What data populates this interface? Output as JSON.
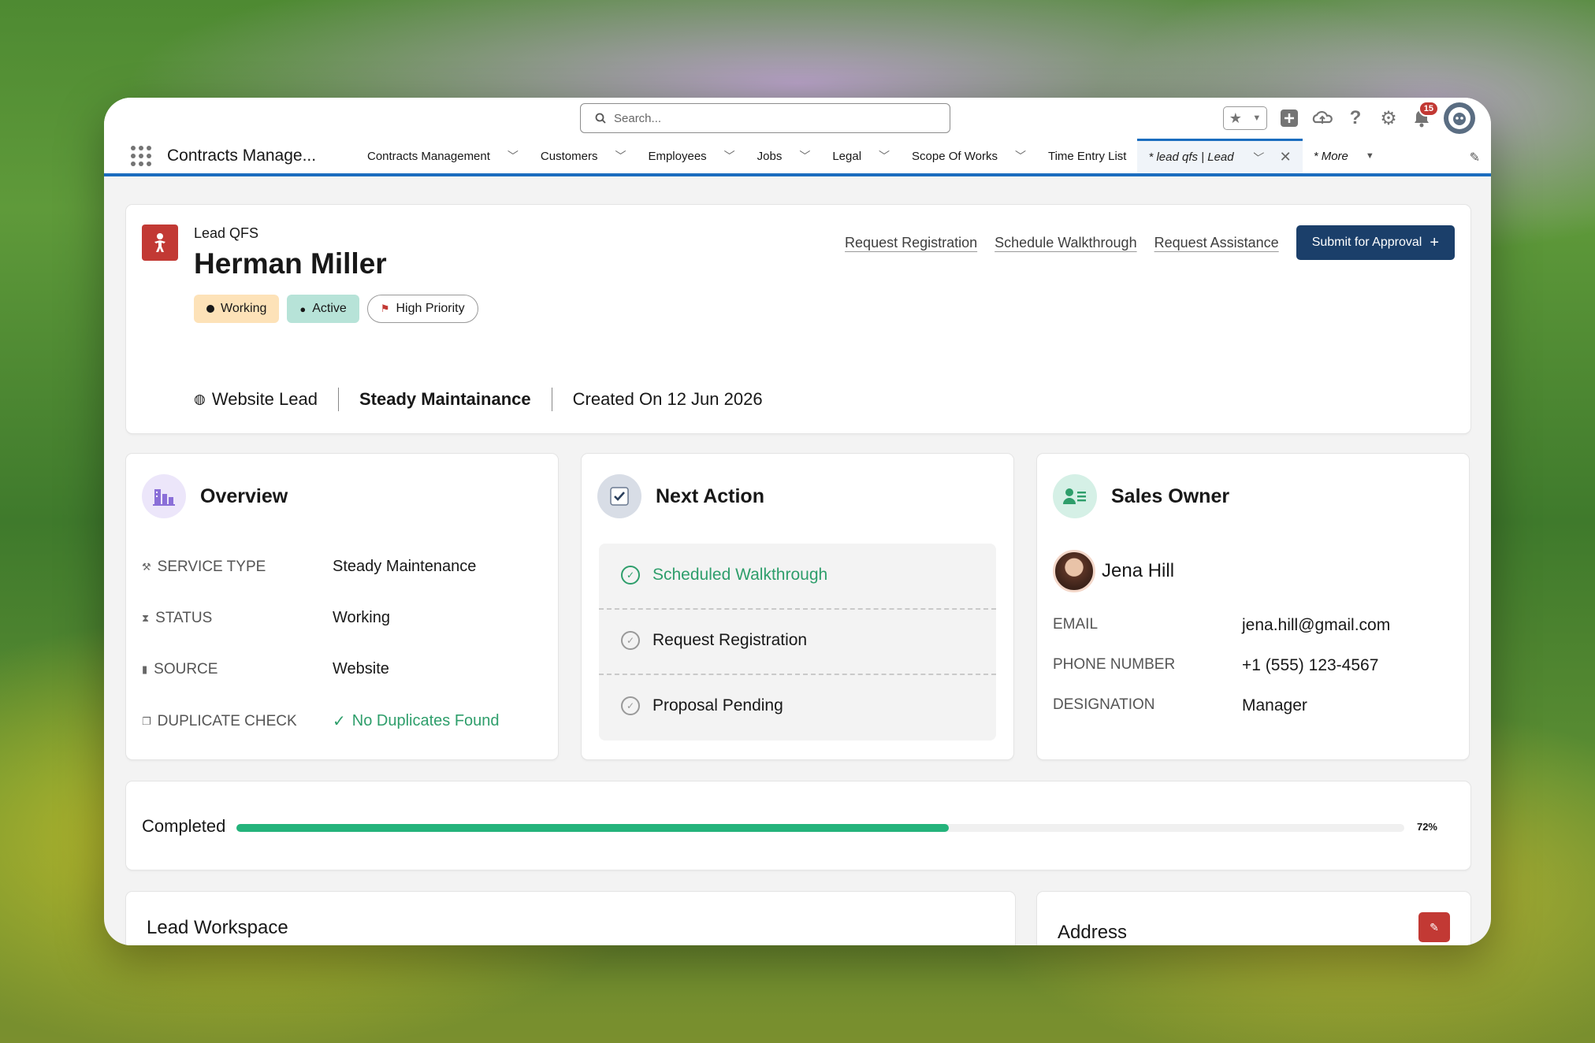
{
  "header": {
    "search_placeholder": "Search...",
    "notification_count": "15"
  },
  "nav": {
    "app_name": "Contracts Manage...",
    "items": [
      {
        "label": "Contracts Management"
      },
      {
        "label": "Customers"
      },
      {
        "label": "Employees"
      },
      {
        "label": "Jobs"
      },
      {
        "label": "Legal"
      },
      {
        "label": "Scope Of Works"
      },
      {
        "label": "Time Entry List"
      }
    ],
    "active_tab": "* lead qfs | Lead",
    "more": "* More"
  },
  "record": {
    "object_label": "Lead QFS",
    "name": "Herman Miller",
    "pills": {
      "working": "Working",
      "active": "Active",
      "priority": "High Priority"
    },
    "actions": {
      "request_registration": "Request Registration",
      "schedule_walkthrough": "Schedule Walkthrough",
      "request_assistance": "Request Assistance",
      "submit": "Submit for Approval"
    },
    "meta": {
      "source": "Website Lead",
      "service": "Steady Maintainance",
      "created": "Created On 12 Jun 2026"
    }
  },
  "overview": {
    "title": "Overview",
    "rows": [
      {
        "label": "SERVICE TYPE",
        "value": "Steady Maintenance"
      },
      {
        "label": "STATUS",
        "value": "Working"
      },
      {
        "label": "SOURCE",
        "value": "Website"
      },
      {
        "label": "DUPLICATE CHECK",
        "value": "No Duplicates Found"
      }
    ]
  },
  "next_action": {
    "title": "Next Action",
    "items": [
      {
        "label": "Scheduled Walkthrough"
      },
      {
        "label": "Request Registration"
      },
      {
        "label": "Proposal Pending"
      }
    ]
  },
  "sales_owner": {
    "title": "Sales Owner",
    "name": "Jena Hill",
    "rows": [
      {
        "label": "EMAIL",
        "value": "jena.hill@gmail.com"
      },
      {
        "label": "PHONE NUMBER",
        "value": "+1 (555) 123-4567"
      },
      {
        "label": "DESIGNATION",
        "value": "Manager"
      }
    ]
  },
  "progress": {
    "label": "Completed",
    "percent_text": "72%",
    "fraction": 0.61
  },
  "workspace": {
    "title": "Lead Workspace"
  },
  "address": {
    "title": "Address"
  },
  "colors": {
    "brand": "#1b6dbf",
    "primary_button": "#1b3f6a",
    "success": "#24b37b",
    "lead_icon": "#c23934"
  }
}
